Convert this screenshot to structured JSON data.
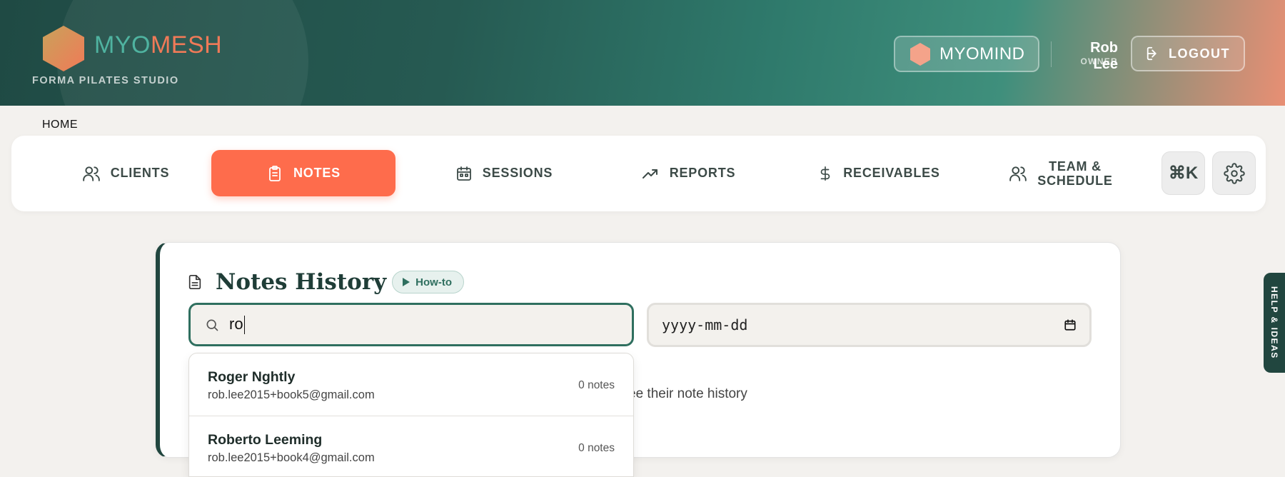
{
  "header": {
    "brand_part1": "MYO",
    "brand_part2": "MESH",
    "studio": "FORMA PILATES STUDIO",
    "myomind_label": "MYOMIND",
    "user_name": "Rob Lee",
    "user_role": "OWNER",
    "logout_label": "LOGOUT"
  },
  "breadcrumb": "HOME",
  "nav": {
    "items": [
      {
        "label": "CLIENTS",
        "icon": "users-icon"
      },
      {
        "label": "NOTES",
        "icon": "clipboard-icon",
        "active": true
      },
      {
        "label": "SESSIONS",
        "icon": "calendar-icon"
      },
      {
        "label": "REPORTS",
        "icon": "trending-up-icon"
      },
      {
        "label": "RECEIVABLES",
        "icon": "dollar-icon"
      },
      {
        "label_line1": "TEAM &",
        "label_line2": "SCHEDULE",
        "icon": "users-icon"
      }
    ],
    "command_label": "⌘K",
    "settings_icon": "gear-icon"
  },
  "notes": {
    "title": "Notes History",
    "howto_label": "How-to",
    "search_value": "ro",
    "date_placeholder": "yyyy-mm-dd",
    "hint_text": "ee their note history"
  },
  "dropdown": {
    "results": [
      {
        "name": "Roger Nghtly",
        "email": "rob.lee2015+book5@gmail.com",
        "count": "0 notes"
      },
      {
        "name": "Roberto Leeming",
        "email": "rob.lee2015+book4@gmail.com",
        "count": "0 notes"
      }
    ]
  },
  "help_tab": "HELP & IDEAS",
  "colors": {
    "accent": "#fe6c4c",
    "dark_green": "#21463f",
    "teal": "#2f6f5f"
  }
}
